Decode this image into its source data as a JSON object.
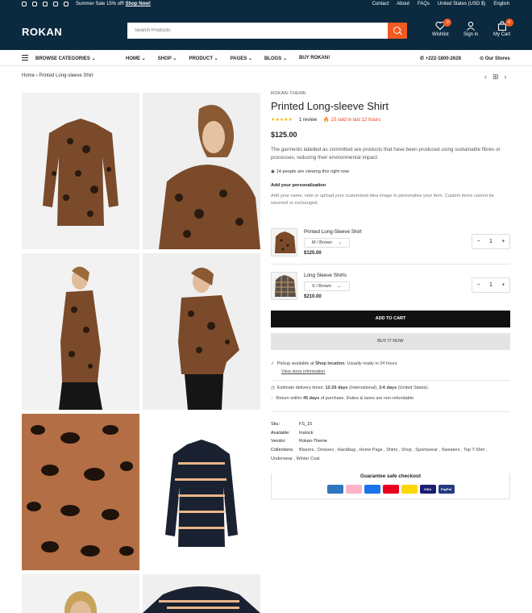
{
  "topbar": {
    "social_icons": [
      "instagram-icon",
      "tiktok-icon",
      "youtube-icon",
      "x-icon",
      "facebook-icon"
    ],
    "sale_text": "Summer Sale 15% off!",
    "sale_link": "Shop Now!",
    "links": [
      "Contact",
      "About",
      "FAQs",
      "United States (USD $)",
      "English"
    ]
  },
  "header": {
    "logo": "ROKAN",
    "search_placeholder": "Search Products",
    "wishlist_label": "Wishlist",
    "wishlist_count": "0",
    "signin_label": "Sign in",
    "cart_label": "My Cart",
    "cart_count": "4",
    "accent_color": "#f15a22",
    "bg_color": "#0b2a3f"
  },
  "nav": {
    "browse": "BROWSE CATEGORIES",
    "items": [
      "HOME",
      "SHOP",
      "PRODUCT",
      "PAGES",
      "BLOGS",
      "BUY ROKAN!"
    ],
    "phone": "+222-1800-2628",
    "stores": "Our Stores"
  },
  "breadcrumb": {
    "home": "Home",
    "current": "Printed Long-sleeve Shirt"
  },
  "product": {
    "vendor": "ROKAN-THEME",
    "title": "Printed Long-sleeve Shirt",
    "review_text": "1 review",
    "sold_text": "15 sold in last 12 hours",
    "price": "$125.00",
    "description": "The garments labelled as committed are products that have been produced using sustainable fibres or processes, reducing their environmental impact.",
    "viewing": "14 people are viewing this right now",
    "personal_title": "Add your personalization",
    "personal_note": "Add your name, note or upload your customized idea image to personalise your item. Custom items cannot be returned or exchanged.",
    "bundle": [
      {
        "name": "Printed Long-Sleeve Shirt",
        "variant": "M / Brown",
        "price": "$125.00",
        "qty": "1"
      },
      {
        "name": "Long Sleeve Shirts",
        "variant": "S / Brown",
        "price": "$210.00",
        "qty": "1"
      }
    ],
    "add_to_cart": "ADD TO CART",
    "buy_now": "BUY IT NOW",
    "pickup_prefix": "Pickup available at",
    "pickup_location": "Shop location",
    "pickup_suffix": ". Usually ready in 24 hours",
    "store_info_link": "View store information",
    "delivery_prefix": "Estimate delivery times:",
    "delivery_intl": "12-26 days",
    "delivery_intl_suffix": "(International),",
    "delivery_us": "3-6 days",
    "delivery_us_suffix": "(United States).",
    "return_prefix": "Return within",
    "return_days": "45 days",
    "return_suffix": "of purchase. Duties & taxes are non-refundable.",
    "meta": {
      "sku_label": "Sku:",
      "sku": "FS_15",
      "available_label": "Available:",
      "available": "Instock",
      "vendor_label": "Vendor:",
      "vendor": "Rokan-Theme",
      "collections_label": "Collections:",
      "collections": "Blazers , Dresses , Handbag , Home Page , Shirts , Shop , Sportswear , Sweaters , Top T-Shirt , Underwear , Winter Coat"
    },
    "checkout_title": "Guarantee safe checkout",
    "payments": [
      {
        "name": "AMEX",
        "color": "#2e77bc"
      },
      {
        "name": "Klarna.",
        "color": "#ffb3c7"
      },
      {
        "name": "G Pay",
        "color": "#1a73e8"
      },
      {
        "name": "MC",
        "color": "#eb001b"
      },
      {
        "name": "VISA",
        "color": "#ffd700"
      },
      {
        "name": "VISA",
        "color": "#1a1f71"
      },
      {
        "name": "PayPal",
        "color": "#253b80"
      }
    ]
  }
}
